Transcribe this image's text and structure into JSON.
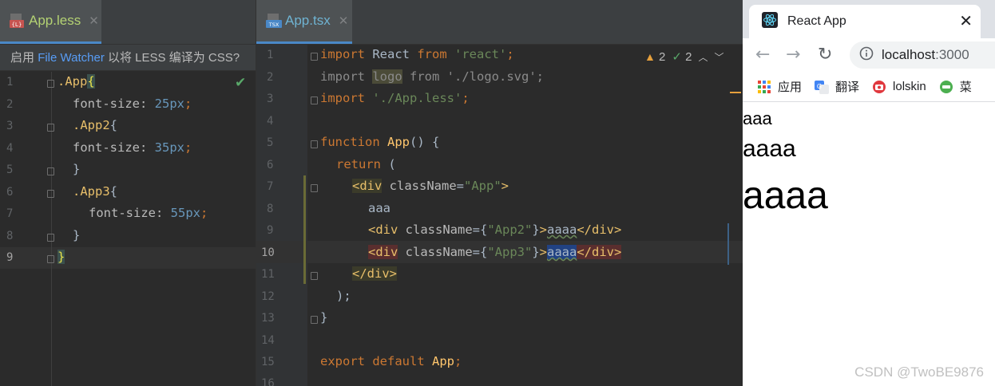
{
  "less_editor": {
    "tab_label": "App.less",
    "watcher_prefix": "启用",
    "watcher_link": "File Watcher",
    "watcher_suffix": "以将 LESS 编译为 CSS?",
    "line_numbers": [
      "1",
      "2",
      "3",
      "4",
      "5",
      "6",
      "7",
      "8",
      "9"
    ],
    "current_line": "9",
    "lines": {
      "l1_sel": ".App",
      "l1_brace": "{",
      "l2_prop": "font-size: ",
      "l2_num": "25px",
      "l2_end": ";",
      "l3_sel": ".App2",
      "l3_brace": "{",
      "l4_prop": "font-size: ",
      "l4_num": "35px",
      "l4_end": ";",
      "l5_text": "}",
      "l6_sel": ".App3",
      "l6_brace": "{",
      "l7_prop": "font-size: ",
      "l7_num": "55px",
      "l7_end": ";",
      "l8_text": "}",
      "l9_text": "}"
    }
  },
  "tsx_editor": {
    "tab_label": "App.tsx",
    "line_numbers": [
      "1",
      "2",
      "3",
      "4",
      "5",
      "6",
      "7",
      "8",
      "9",
      "10",
      "11",
      "12",
      "13",
      "14",
      "15",
      "16"
    ],
    "current_line": "10",
    "inspection": {
      "warnings": "2",
      "ok": "2"
    },
    "lines": {
      "l1_kw": "import",
      "l1_id": " React ",
      "l1_from": "from",
      "l1_str": " 'react'",
      "l1_end": ";",
      "l2_kw": "import",
      "l2_id": "logo",
      "l2_from": " from ",
      "l2_str": "'./logo.svg'",
      "l2_end": ";",
      "l3_kw": "import",
      "l3_str": " './App.less'",
      "l3_end": ";",
      "l5_kw": "function",
      "l5_fn": " App",
      "l5_rest": "() {",
      "l6_kw": "return",
      "l6_rest": " (",
      "l7_open": "<div",
      "l7_attr": " className",
      "l7_eq": "=",
      "l7_str": "\"App\"",
      "l7_close": ">",
      "l8_text": "aaa",
      "l9_open": "<div",
      "l9_attr": " className",
      "l9_eq": "={",
      "l9_str": "\"App2\"",
      "l9_brace": "}",
      "l9_gt": ">",
      "l9_text": "aaaa",
      "l9_closetag": "</div>",
      "l10_open": "<div",
      "l10_attr": " className",
      "l10_eq": "={",
      "l10_str": "\"App3\"",
      "l10_brace": "}",
      "l10_gt": ">",
      "l10_text": "aaaa",
      "l10_closetag": "</div>",
      "l11_text": "</div>",
      "l12_text": ");",
      "l13_text": "}",
      "l15_kw": "export default",
      "l15_id": " App",
      "l15_end": ";"
    }
  },
  "browser": {
    "tab_title": "React App",
    "url_host": "localhost",
    "url_port": ":3000",
    "bookmarks": [
      "应用",
      "翻译",
      "lolskin",
      "菜"
    ],
    "page_text": [
      "aaa",
      "aaaa",
      "aaaa"
    ]
  },
  "watermark": "CSDN @TwoBE9876",
  "colors": {
    "editor_bg": "#2b2b2b",
    "keyword": "#cc7832",
    "string": "#6a8759",
    "number": "#6897bb",
    "tag": "#e8bf6a",
    "tab_label": "#b4d273",
    "link": "#589df6"
  }
}
